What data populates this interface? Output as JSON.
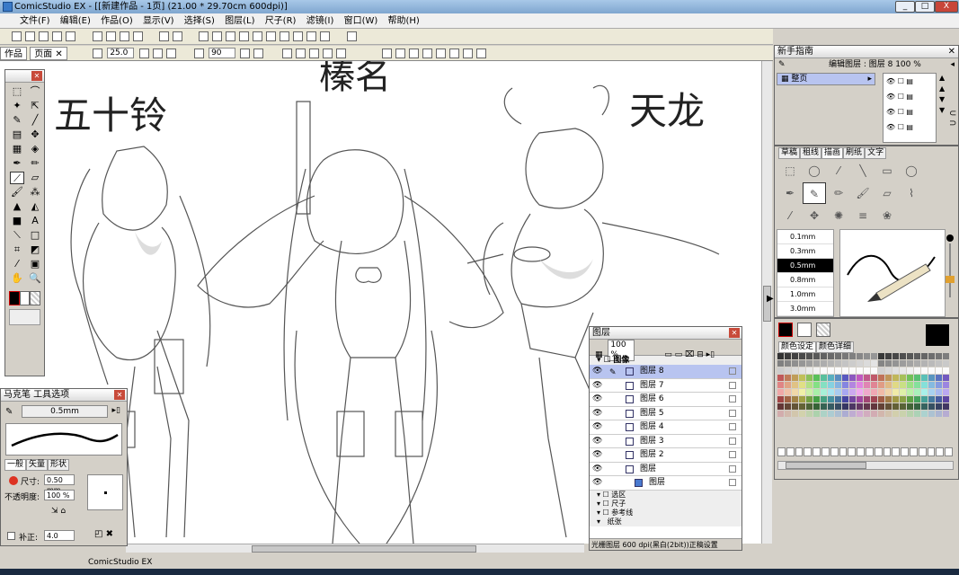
{
  "window": {
    "title": "ComicStudio EX - [[新建作品 - 1页] (21.00 * 29.70cm 600dpi)]",
    "min": "_",
    "max": "□",
    "close": "X"
  },
  "menu": [
    "文件(F)",
    "编辑(E)",
    "作品(O)",
    "显示(V)",
    "选择(S)",
    "图层(L)",
    "尺子(R)",
    "滤镜(I)",
    "窗口(W)",
    "帮助(H)"
  ],
  "tabs": {
    "works": "作品",
    "page": "页面"
  },
  "toolbar": {
    "zoom": "25.0",
    "rotate": "90"
  },
  "canvas": {
    "label_left": "五十铃",
    "label_mid": "榛名",
    "label_right": "天龙"
  },
  "tool_options": {
    "title": "马克笔 工具选项",
    "brush_size": "0.5mm",
    "tabs": [
      "一般",
      "矢量",
      "形状"
    ],
    "size_label": "尺寸:",
    "size_value": "0.50",
    "size_unit": "mm",
    "opacity_label": "不透明度:",
    "opacity_value": "100",
    "opacity_unit": "%",
    "correction_label": "补正:",
    "correction_value": "4.0"
  },
  "layers": {
    "title": "图层",
    "zoom": "100 %",
    "group": "图像",
    "items": [
      "图层 8",
      "图层 7",
      "图层 6",
      "图层 5",
      "图层 4",
      "图层 3",
      "图层 2",
      "图层",
      "图层"
    ],
    "folders": [
      "选区",
      "尺子",
      "参考线",
      "纸张"
    ],
    "status": "光栅图层 600 dpi(黑白(2bit))正稿设置"
  },
  "navigator": {
    "title": "新手指南",
    "layer_label": "编辑图层 : 图层 8  100 %",
    "page_item": "整页"
  },
  "subtool": {
    "tabs": [
      "草稿",
      "租线",
      "描画",
      "刷纸",
      "文字"
    ],
    "sizes": [
      "0.1mm",
      "0.3mm",
      "0.5mm",
      "0.8mm",
      "1.0mm",
      "3.0mm"
    ],
    "selected_size": "0.5mm"
  },
  "color": {
    "tabs": [
      "颜色设定",
      "颜色详细"
    ],
    "main_color": "#000000",
    "sub_color": "#ffffff"
  },
  "statusbar": {
    "app": "ComicStudio EX"
  }
}
